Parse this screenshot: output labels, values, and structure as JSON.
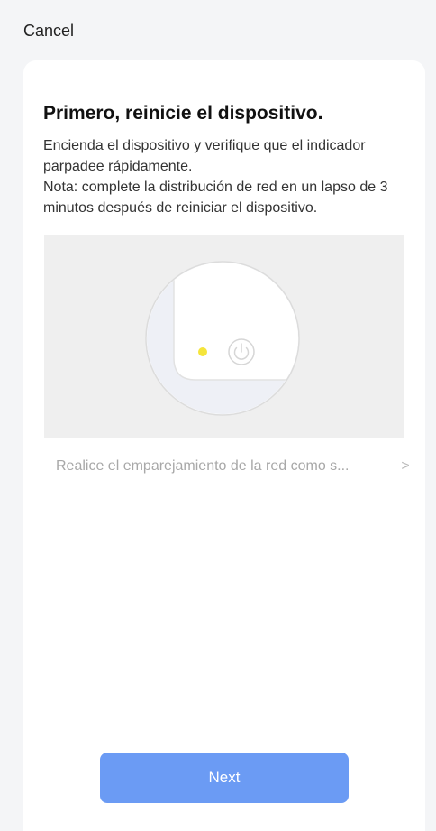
{
  "header": {
    "cancel_label": "Cancel"
  },
  "card": {
    "title": "Primero, reinicie el dispositivo.",
    "description": "Encienda el dispositivo y verifique que el indicador parpadee rápidamente.\nNota: complete la distribución de red en un lapso de 3 minutos después de reiniciar el dispositivo.",
    "illustration": {
      "indicator_color": "#f5e53b",
      "icon": "power-icon"
    },
    "guide_link_text": "Realice el emparejamiento de la red como s...",
    "guide_link_icon": "chevron-right-icon"
  },
  "footer": {
    "next_label": "Next",
    "accent_color": "#6b9bf4"
  }
}
